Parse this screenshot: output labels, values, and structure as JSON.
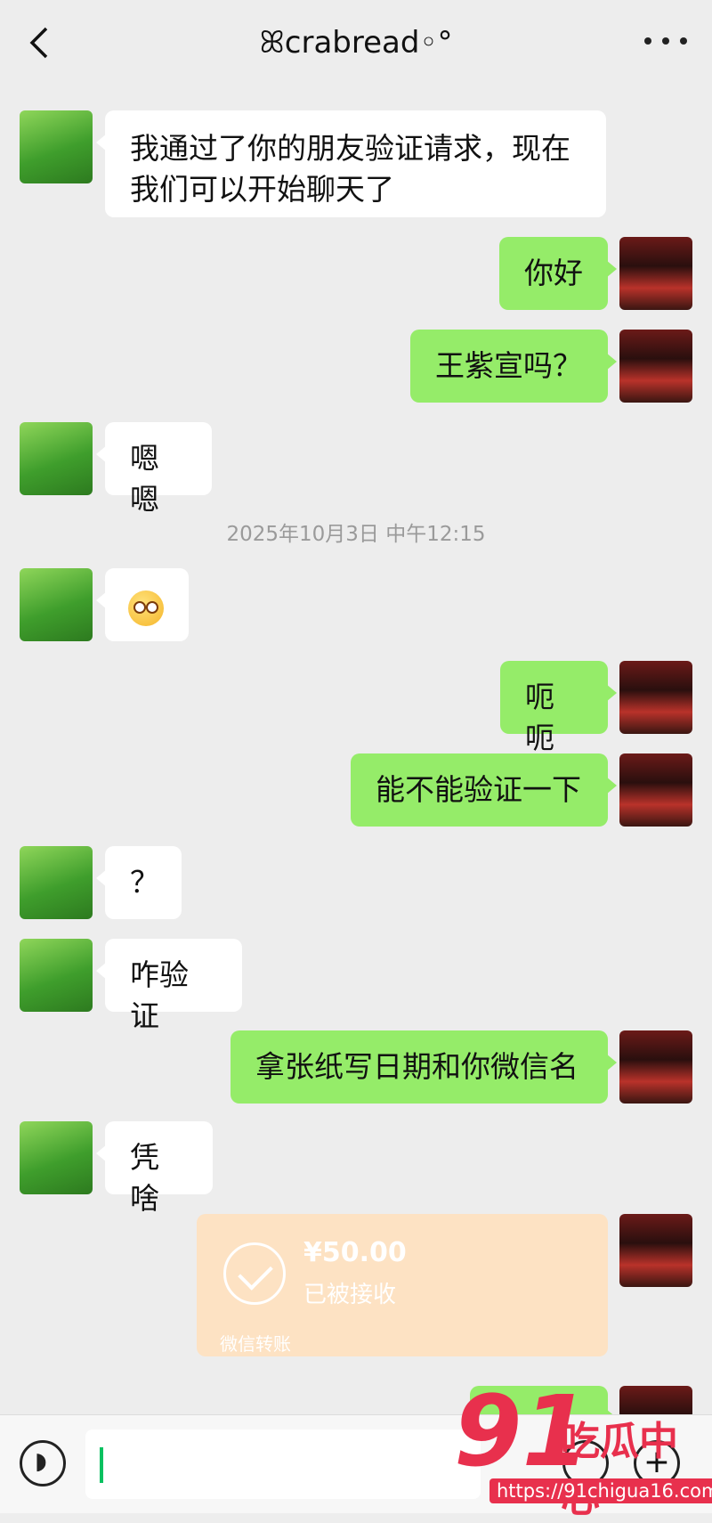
{
  "header": {
    "back_icon": "chevron-left-icon",
    "title": "ꕤcrabread◦°",
    "more_icon": "more-dots-icon"
  },
  "messages": [
    {
      "side": "in",
      "text": "我通过了你的朋友验证请求，现在我们可以开始聊天了"
    },
    {
      "side": "out",
      "text": "你好"
    },
    {
      "side": "out",
      "text": "王紫宣吗？"
    },
    {
      "side": "in",
      "text": "嗯嗯"
    },
    {
      "side": "in",
      "text": "",
      "emoji": "flushed-face-emoji"
    },
    {
      "side": "out",
      "text": "呃呃"
    },
    {
      "side": "out",
      "text": "能不能验证一下"
    },
    {
      "side": "in",
      "text": "？"
    },
    {
      "side": "in",
      "text": "咋验证"
    },
    {
      "side": "out",
      "text": "拿张纸写日期和你微信名"
    },
    {
      "side": "in",
      "text": "凭啥"
    },
    {
      "side": "out",
      "text": ""
    }
  ],
  "timestamp": "2025年10月3日 中午12:15",
  "transfer": {
    "amount": "¥50.00",
    "status": "已被接收",
    "label": "微信转账"
  },
  "input": {
    "value": ""
  },
  "watermark": {
    "number": "91",
    "brand": "吃瓜中心",
    "url": "https://91chigua16.com"
  },
  "colors": {
    "background": "#ededed",
    "incoming_bubble": "#ffffff",
    "outgoing_bubble": "#95ec69",
    "transfer_card": "#fde2c3",
    "watermark": "#e8304d"
  }
}
